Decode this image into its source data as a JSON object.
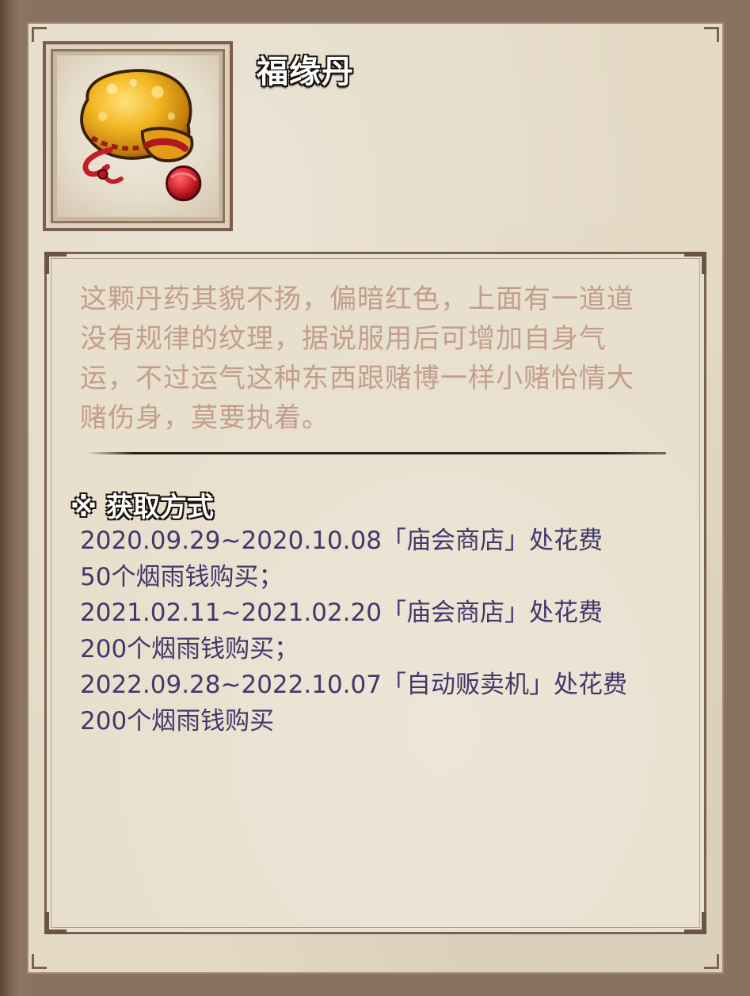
{
  "item": {
    "name": "福缘丹",
    "icon": "golden-pouch-icon",
    "description": "这颗丹药其貌不扬，偏暗红色，上面有一道道没有规律的纹理，据说服用后可增加自身气运，不过运气这种东西跟赌博一样小赌怡情大赌伤身，莫要执着。"
  },
  "acquisition": {
    "heading": "※ 获取方式",
    "lines": [
      "2020.09.29~2020.10.08「庙会商店」处花费",
      "50个烟雨钱购买；",
      "2021.02.11~2021.02.20「庙会商店」处花费",
      "200个烟雨钱购买；",
      "2022.09.28~2022.10.07「自动贩卖机」处花费",
      "200个烟雨钱购买"
    ]
  },
  "colors": {
    "description_text": "#c29f8c",
    "acquisition_text": "#3e3a6a",
    "paper": "#e4dac6",
    "frame": "#7a6252"
  }
}
